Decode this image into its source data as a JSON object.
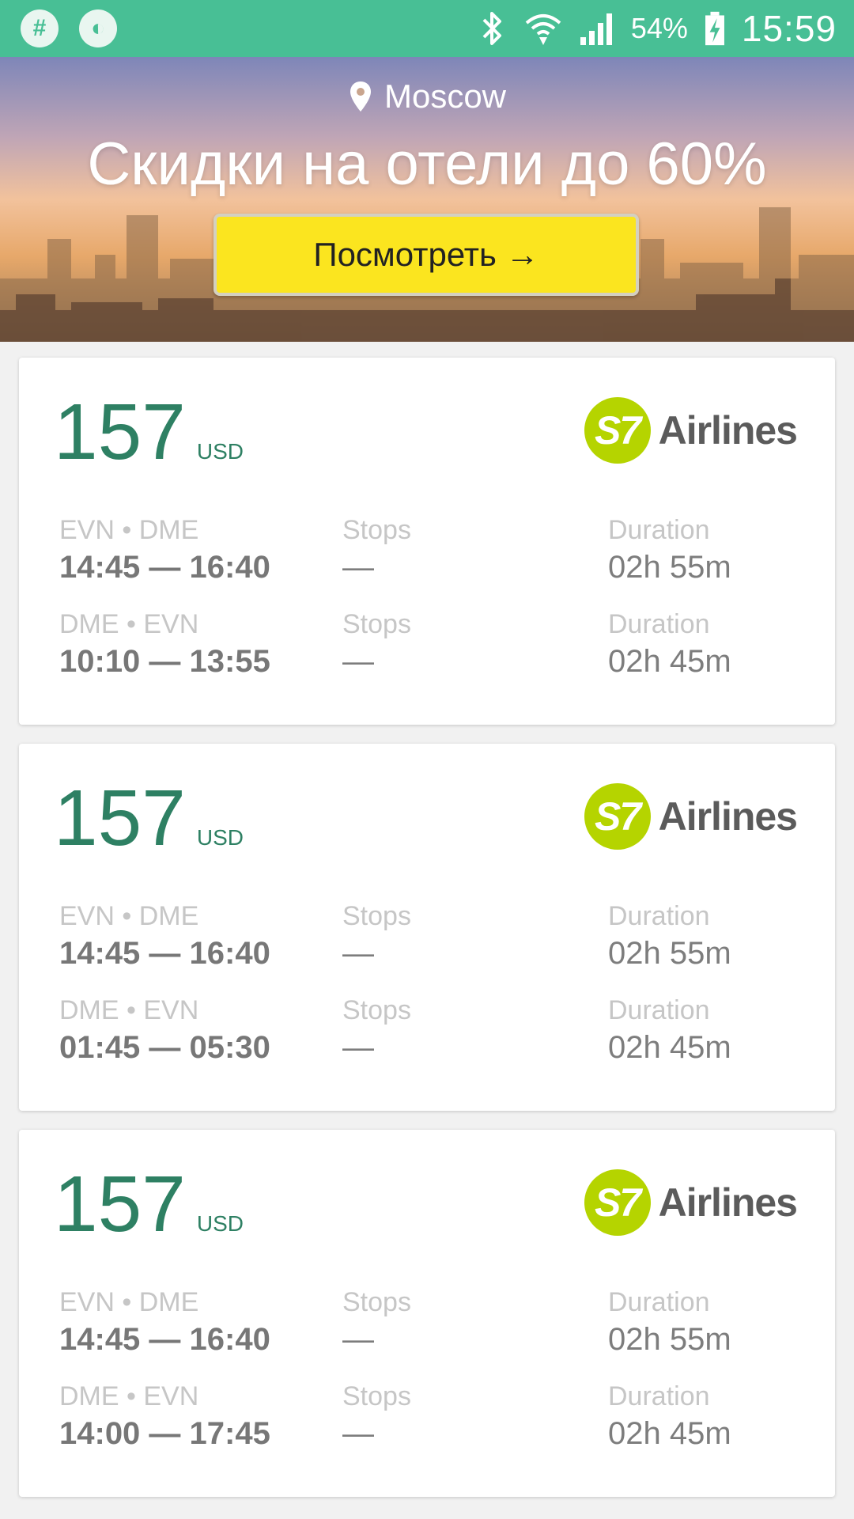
{
  "status_bar": {
    "battery": "54%",
    "time": "15:59",
    "icons": [
      "hashtag-icon",
      "firefox-icon",
      "bluetooth-icon",
      "wifi-icon",
      "signal-icon",
      "battery-charging-icon"
    ]
  },
  "hero": {
    "location": "Moscow",
    "title": "Скидки на отели до 60%",
    "button_label": "Посмотреть →"
  },
  "colors": {
    "status_bar": "#48bf95",
    "price": "#2e8063",
    "button": "#fbe51f",
    "airline_mark": "#b5d400"
  },
  "flights": [
    {
      "price": "157",
      "currency": "USD",
      "airline": {
        "mark": "S7",
        "name": "Airlines"
      },
      "legs": [
        {
          "route": "EVN • DME",
          "times": "14:45 — 16:40",
          "stops_label": "Stops",
          "stops": "—",
          "duration_label": "Duration",
          "duration": "02h 55m"
        },
        {
          "route": "DME • EVN",
          "times": "10:10 — 13:55",
          "stops_label": "Stops",
          "stops": "—",
          "duration_label": "Duration",
          "duration": "02h 45m"
        }
      ]
    },
    {
      "price": "157",
      "currency": "USD",
      "airline": {
        "mark": "S7",
        "name": "Airlines"
      },
      "legs": [
        {
          "route": "EVN • DME",
          "times": "14:45 — 16:40",
          "stops_label": "Stops",
          "stops": "—",
          "duration_label": "Duration",
          "duration": "02h 55m"
        },
        {
          "route": "DME • EVN",
          "times": "01:45 — 05:30",
          "stops_label": "Stops",
          "stops": "—",
          "duration_label": "Duration",
          "duration": "02h 45m"
        }
      ]
    },
    {
      "price": "157",
      "currency": "USD",
      "airline": {
        "mark": "S7",
        "name": "Airlines"
      },
      "legs": [
        {
          "route": "EVN • DME",
          "times": "14:45 — 16:40",
          "stops_label": "Stops",
          "stops": "—",
          "duration_label": "Duration",
          "duration": "02h 55m"
        },
        {
          "route": "DME • EVN",
          "times": "14:00 — 17:45",
          "stops_label": "Stops",
          "stops": "—",
          "duration_label": "Duration",
          "duration": "02h 45m"
        }
      ]
    }
  ]
}
